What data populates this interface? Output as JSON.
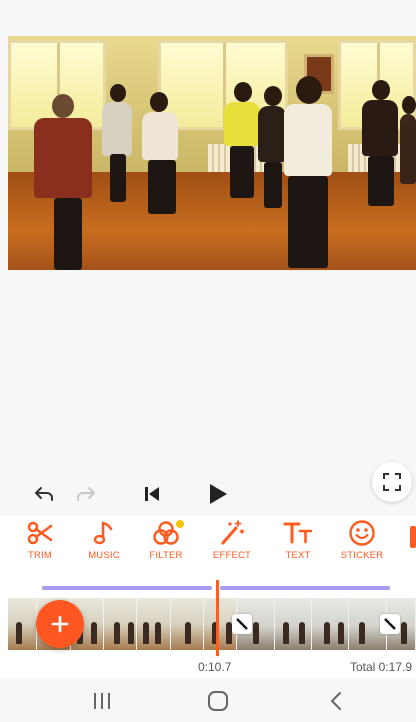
{
  "player": {
    "undo_icon": "undo-arrow-icon",
    "redo_icon": "redo-arrow-icon",
    "skip_start_icon": "skip-to-start-icon",
    "play_icon": "play-icon",
    "fullscreen_icon": "fullscreen-icon"
  },
  "tools": [
    {
      "label": "TRIM",
      "icon": "scissors-icon"
    },
    {
      "label": "MUSIC",
      "icon": "music-note-icon"
    },
    {
      "label": "FILTER",
      "icon": "filter-circles-icon",
      "badge": true
    },
    {
      "label": "EFFECT",
      "icon": "magic-wand-icon"
    },
    {
      "label": "TEXT",
      "icon": "text-icon"
    },
    {
      "label": "STICKER",
      "icon": "smiley-icon"
    }
  ],
  "timeline": {
    "current_time": "0:10.7",
    "total_time": "Total 0:17.9",
    "add_icon": "plus-icon"
  },
  "colors": {
    "accent": "#ff5a1f",
    "audio_track": "#a79bf0",
    "badge": "#f5c400"
  },
  "navigation": {
    "recents_icon": "recents-icon",
    "home_icon": "home-icon",
    "back_icon": "back-icon"
  }
}
